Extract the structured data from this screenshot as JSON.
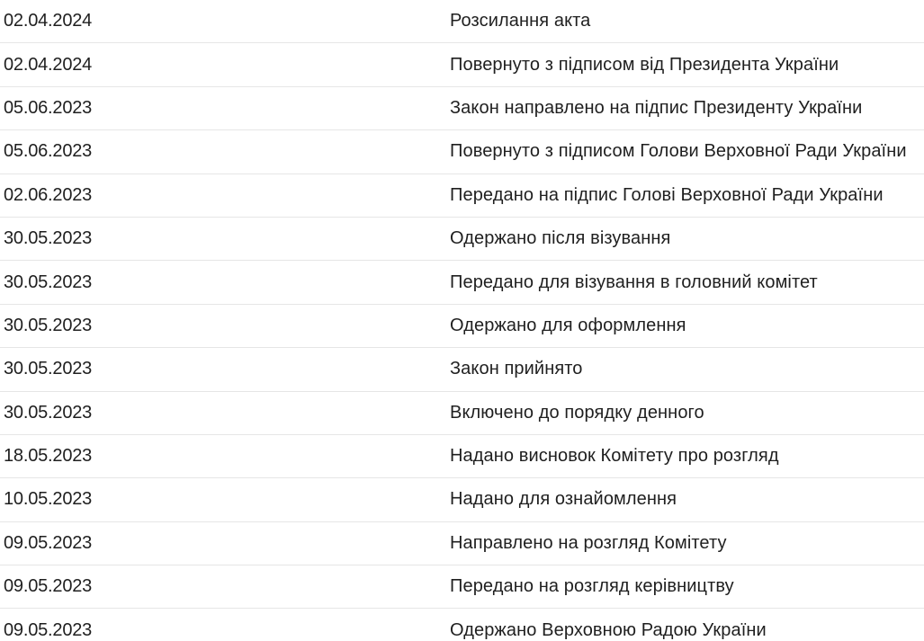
{
  "history": {
    "rows": [
      {
        "date": "02.04.2024",
        "event": "Розсилання акта"
      },
      {
        "date": "02.04.2024",
        "event": "Повернуто з підписом від Президента України"
      },
      {
        "date": "05.06.2023",
        "event": "Закон направлено на підпис Президенту України"
      },
      {
        "date": "05.06.2023",
        "event": "Повернуто з підписом Голови Верховної Ради України"
      },
      {
        "date": "02.06.2023",
        "event": "Передано на підпис Голові Верховної Ради України"
      },
      {
        "date": "30.05.2023",
        "event": "Одержано після візування"
      },
      {
        "date": "30.05.2023",
        "event": "Передано для візування в головний комітет"
      },
      {
        "date": "30.05.2023",
        "event": "Одержано для оформлення"
      },
      {
        "date": "30.05.2023",
        "event": "Закон прийнято"
      },
      {
        "date": "30.05.2023",
        "event": "Включено до порядку денного"
      },
      {
        "date": "18.05.2023",
        "event": "Надано висновок Комітету про розгляд"
      },
      {
        "date": "10.05.2023",
        "event": "Надано для ознайомлення"
      },
      {
        "date": "09.05.2023",
        "event": "Направлено на розгляд Комітету"
      },
      {
        "date": "09.05.2023",
        "event": "Передано на розгляд керівництву"
      },
      {
        "date": "09.05.2023",
        "event": "Одержано Верховною Радою України"
      }
    ]
  }
}
